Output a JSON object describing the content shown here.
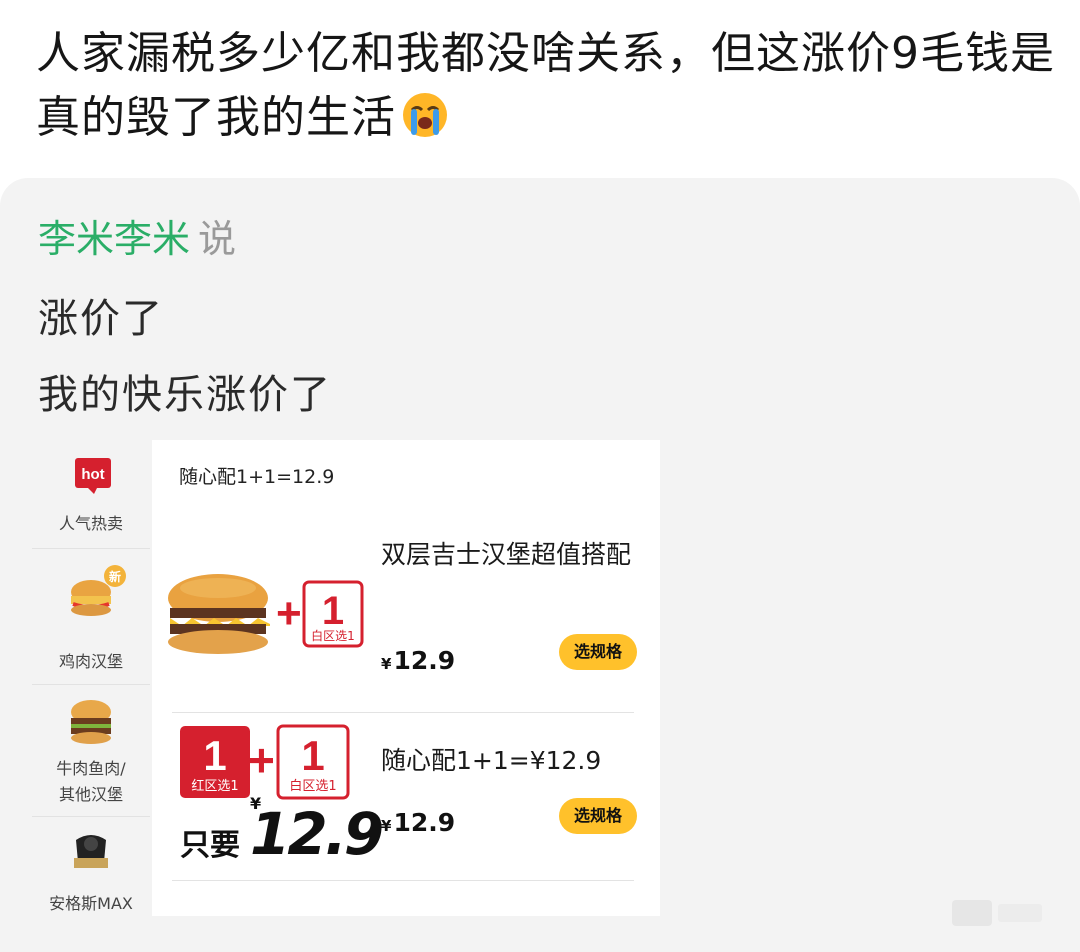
{
  "post": {
    "text": "人家漏税多少亿和我都没啥关系，但这涨价9毛钱是真的毁了我的生活"
  },
  "quote": {
    "author": "李米李米",
    "says": "说",
    "lines": [
      "涨价了",
      "我的快乐涨价了"
    ]
  },
  "screenshot": {
    "sidebar": [
      {
        "icon": "hot-icon",
        "badge": "hot",
        "label": "人气热卖"
      },
      {
        "icon": "chicken-burger-icon",
        "badge": "新",
        "label": "鸡肉汉堡"
      },
      {
        "icon": "beef-burger-icon",
        "label_line1": "牛肉鱼肉/",
        "label_line2": "其他汉堡"
      },
      {
        "icon": "angus-max-icon",
        "label": "安格斯MAX"
      }
    ],
    "section_title": "随心配1+1=12.9",
    "items": [
      {
        "name": "双层吉士汉堡超值搭配",
        "currency": "¥",
        "price": "12.9",
        "button": "选规格",
        "badge_num": "1",
        "badge_sub": "白区选1"
      },
      {
        "name": "随心配1+1=¥12.9",
        "currency": "¥",
        "price": "12.9",
        "button": "选规格",
        "badge_red_num": "1",
        "badge_red_sub": "红区选1",
        "badge_num": "1",
        "badge_sub": "白区选1",
        "promo_only": "只要",
        "promo_currency": "¥",
        "promo_price": "12.9"
      }
    ]
  },
  "colors": {
    "author_green": "#2aae67",
    "brand_red": "#d5202e",
    "button_yellow": "#ffc12b"
  }
}
